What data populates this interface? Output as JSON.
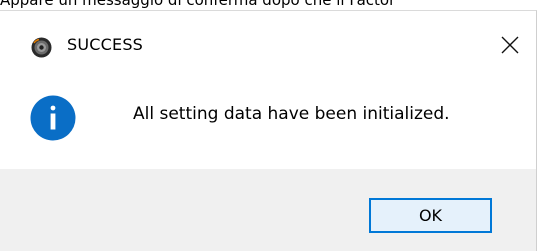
{
  "background_caption": "Appare un messaggio di conferma dopo che il Factor",
  "dialog": {
    "title": "SUCCESS",
    "message": "All setting data have been initialized.",
    "ok_label": "OK",
    "close_icon": "close-icon",
    "status_icon": "info-icon",
    "colors": {
      "accent": "#0078d7",
      "info_icon": "#0a6ec6",
      "footer": "#f0f0f0"
    }
  }
}
